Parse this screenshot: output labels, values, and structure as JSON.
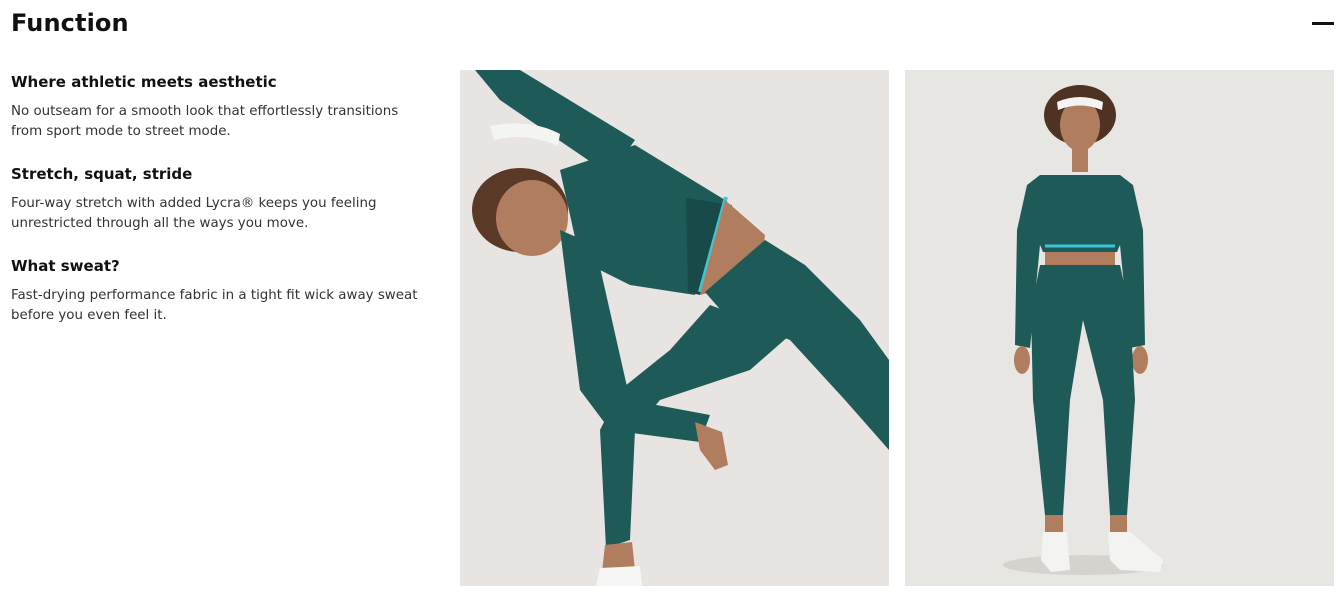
{
  "section": {
    "title": "Function",
    "toggle_icon": "minus-icon"
  },
  "features": [
    {
      "title": "Where athletic meets aesthetic",
      "description": "No outseam for a smooth look that effortlessly transitions from sport mode to street mode."
    },
    {
      "title": "Stretch, squat, stride",
      "description": "Four-way stretch with added Lycra® keeps you feeling unrestricted through all the ways you move."
    },
    {
      "title": "What sweat?",
      "description": "Fast-drying performance fabric in a tight fit wick away sweat before you even feel it."
    }
  ],
  "colors": {
    "background": "#ffffff",
    "photo_background": "#e7e4e1",
    "garment": "#1e5a58",
    "accent_trim": "#3ec6d6",
    "text": "#111111"
  }
}
